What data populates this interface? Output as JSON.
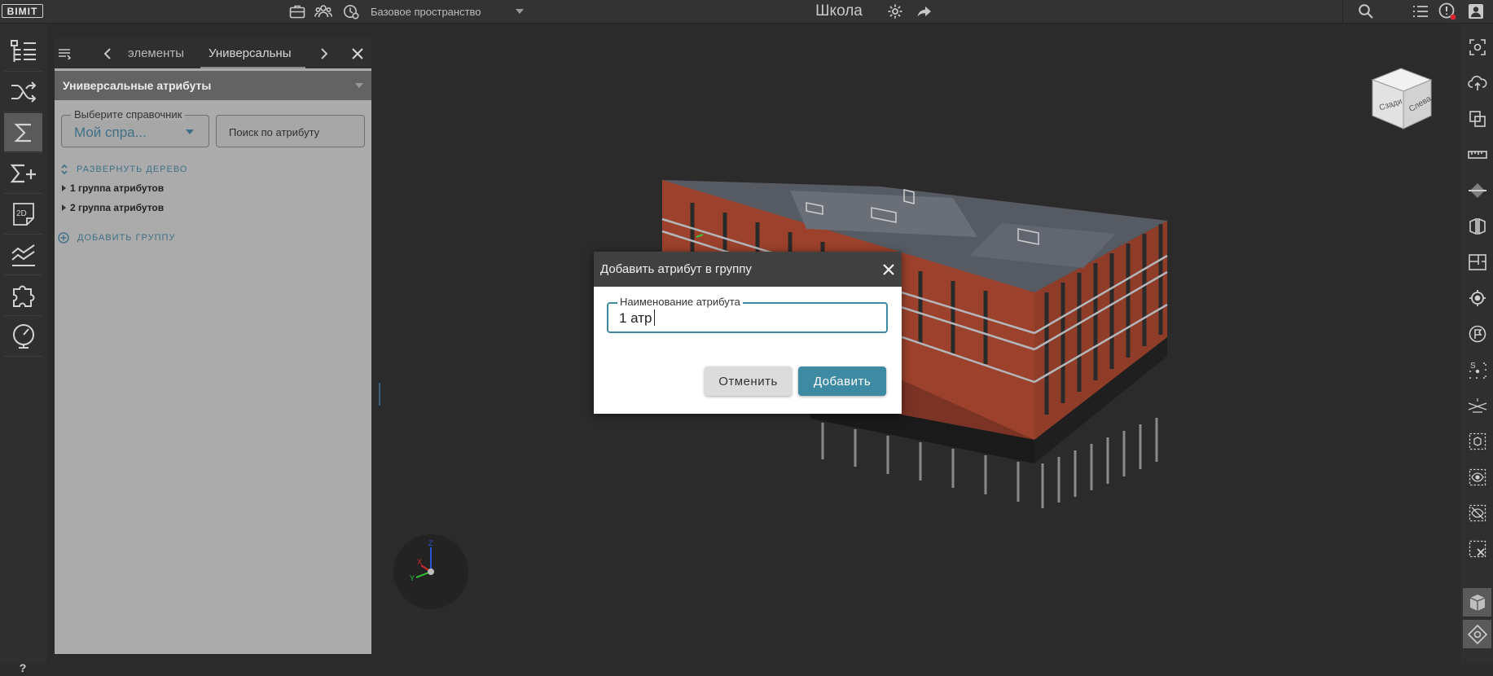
{
  "app": {
    "logo": "BIMIT",
    "project_title": "Школа",
    "space_select": "Базовое пространство"
  },
  "panel": {
    "tabs": [
      {
        "label": "элементы"
      },
      {
        "label": "Универсальны"
      }
    ],
    "section_title": "Универсальные атрибуты",
    "dictionary": {
      "label": "Выберите справочник",
      "value": "Мой спра..."
    },
    "search": {
      "placeholder": "Поиск по атрибуту"
    },
    "expand_tree": "РАЗВЕРНУТЬ ДЕРЕВО",
    "groups": [
      {
        "label": "1 группа атрибутов"
      },
      {
        "label": "2 группа атрибутов"
      }
    ],
    "add_group": "ДОБАВИТЬ ГРУППУ"
  },
  "viewcube": {
    "face_left": "Сзади",
    "face_right": "Слева"
  },
  "axes": {
    "z": "Z",
    "x": "X",
    "y": "Y"
  },
  "dialog": {
    "title": "Добавить атрибут в группу",
    "field_label": "Наименование атрибута",
    "field_value": "1 атр",
    "cancel": "Отменить",
    "add": "Добавить"
  },
  "help": "?"
}
